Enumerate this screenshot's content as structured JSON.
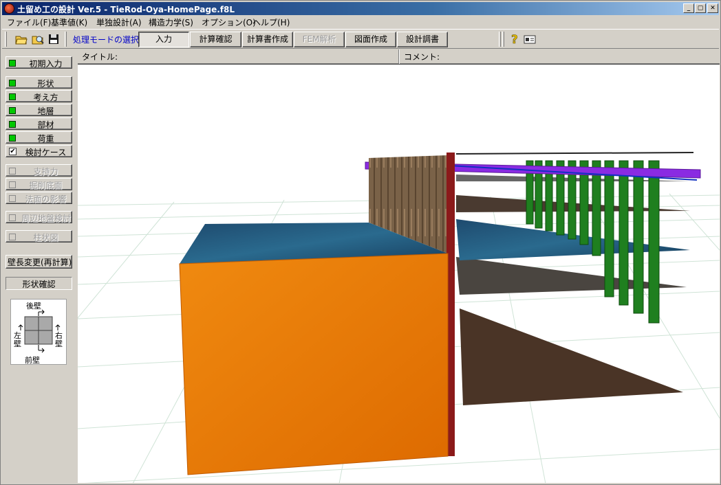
{
  "window": {
    "title": "土留め工の設計 Ver.5 - TieRod-Oya-HomePage.f8L"
  },
  "menu": [
    "ファイル(F)",
    "基準値(K)",
    "単独設計(A)",
    "構造力学(S)",
    "オプション(O)",
    "ヘルプ(H)"
  ],
  "toolbar": {
    "mode_label": "処理モードの選択",
    "buttons": [
      "入力",
      "計算確認",
      "計算書作成",
      "FEM解析",
      "図面作成",
      "設計調書"
    ],
    "active": "入力",
    "disabled": [
      "FEM解析"
    ]
  },
  "header": {
    "title_label": "タイトル:",
    "comment_label": "コメント:"
  },
  "sidebar": {
    "initial_input": "初期入力",
    "items": [
      {
        "label": "形状",
        "state": "done"
      },
      {
        "label": "考え方",
        "state": "done"
      },
      {
        "label": "地層",
        "state": "done"
      },
      {
        "label": "部材",
        "state": "done"
      },
      {
        "label": "荷重",
        "state": "done"
      },
      {
        "label": "検討ケース",
        "state": "checked"
      }
    ],
    "disabled_items": [
      "支持力",
      "掘削底面",
      "法面の影響",
      "周辺地盤検討",
      "柱状図"
    ],
    "recalc": "壁長変更(再計算)",
    "shape_confirm": "形状確認",
    "orientation": {
      "back": "後壁",
      "front": "前壁",
      "left": "左壁",
      "right": "右壁"
    }
  },
  "colors": {
    "wall": "#e47800",
    "pile": "#1f7f1f",
    "water": "#1e4a6e",
    "soil": "#4a3426",
    "tie": "#8a2be2",
    "grid": "#cfe3d6"
  }
}
